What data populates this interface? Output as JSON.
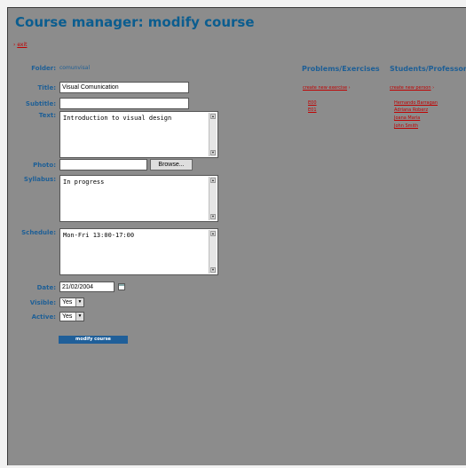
{
  "page": {
    "title": "Course manager: modify course"
  },
  "nav": {
    "exit_bullet": "›",
    "exit_label": "exit"
  },
  "form": {
    "folder": {
      "label": "Folder:",
      "value": "comunvisal"
    },
    "title": {
      "label": "Title:",
      "value": "Visual Comunication"
    },
    "subtitle": {
      "label": "Subtitle:",
      "value": ""
    },
    "text": {
      "label": "Text:",
      "value": "Introduction to visual design"
    },
    "photo": {
      "label": "Photo:",
      "value": "",
      "browse_label": "Browse..."
    },
    "syllabus": {
      "label": "Syllabus:",
      "value": "In progress"
    },
    "schedule": {
      "label": "Schedule:",
      "value": "Mon-Fri 13:00-17:00"
    },
    "date": {
      "label": "Date:",
      "value": "21/02/2004"
    },
    "visible": {
      "label": "Visible:",
      "value": "Yes"
    },
    "active": {
      "label": "Active:",
      "value": "Yes"
    },
    "submit_label": "modify course"
  },
  "exercises": {
    "heading": "Problems/Exercises",
    "create_label": "create new exercise",
    "create_bullet": "›",
    "items": [
      "E00",
      "E01"
    ]
  },
  "students": {
    "heading": "Students/Professors",
    "create_label": "create new person",
    "create_bullet": "›",
    "items": [
      "Hernando Barragan",
      "Adriana Roberz",
      "Joana Maria",
      "John Smith"
    ]
  },
  "icons": {
    "scroll_up": "scroll-up-arrow-icon",
    "scroll_down": "scroll-down-arrow-icon",
    "calendar": "calendar-icon",
    "dropdown": "chevron-down-icon"
  },
  "colors": {
    "background": "#8c8c8c",
    "heading": "#0b5d8f",
    "label": "#1e5f96",
    "link": "#c00000",
    "button": "#1f5f99"
  }
}
